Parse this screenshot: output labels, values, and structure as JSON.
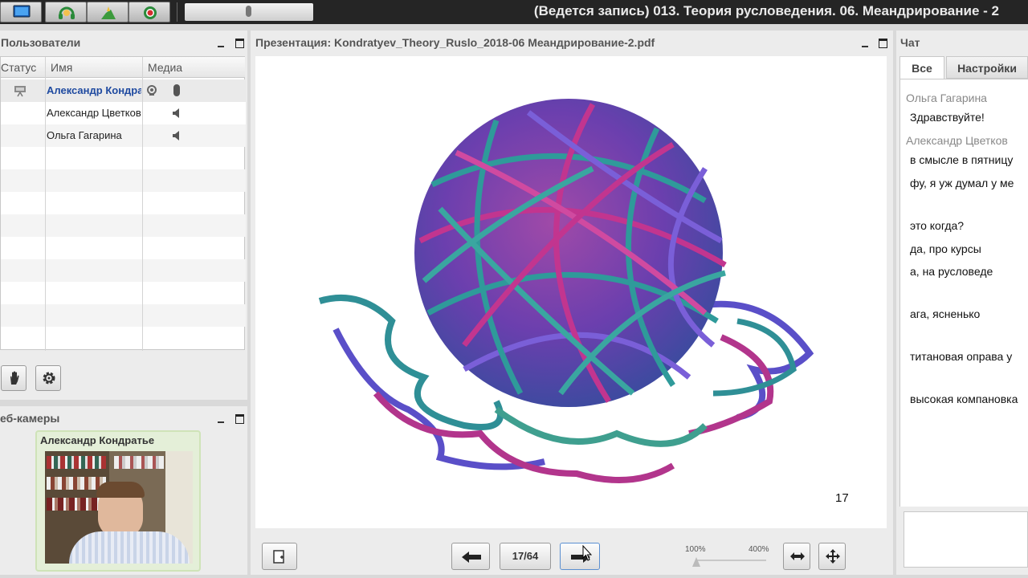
{
  "window": {
    "title": "(Ведется запись) 013. Теория русловедения. 06. Меандрирование - 2"
  },
  "toolbar": {
    "buttons": [
      {
        "name": "desktop-share",
        "icon": "monitor-icon"
      },
      {
        "name": "headset",
        "icon": "headset-icon"
      },
      {
        "name": "upload-document",
        "icon": "document-upload-icon"
      },
      {
        "name": "record",
        "icon": "record-icon"
      }
    ]
  },
  "users_panel": {
    "title": "Пользователи",
    "columns": [
      "Статус",
      "Имя",
      "Медиа"
    ],
    "rows": [
      {
        "name": "Александр Кондра",
        "presenter": true
      },
      {
        "name": "Александр Цветков",
        "presenter": false
      },
      {
        "name": "Ольга Гагарина",
        "presenter": false
      }
    ]
  },
  "webcam_panel": {
    "title": "Веб-камеры",
    "title_visible": "еб-камеры",
    "user": "Александр Кондратье"
  },
  "presentation": {
    "title": "Презентация: Kondratyev_Theory_Ruslo_2018-06 Меандрирование-2.pdf",
    "slide_number": "17",
    "page_counter": "17/64",
    "zoom_min": "100%",
    "zoom_max": "400%",
    "zoom_level": 0
  },
  "chat_panel": {
    "title": "Чат",
    "tabs": [
      "Все",
      "Настройки"
    ],
    "messages": [
      {
        "type": "name",
        "text": "Ольга Гагарина"
      },
      {
        "type": "text",
        "text": "Здравствуйте!"
      },
      {
        "type": "name",
        "text": "Александр Цветков"
      },
      {
        "type": "text",
        "text": "в смысле в пятницу"
      },
      {
        "type": "text",
        "text": "фу, я уж думал у ме"
      },
      {
        "type": "text",
        "text": "это когда?"
      },
      {
        "type": "text",
        "text": "да, про курсы"
      },
      {
        "type": "text",
        "text": "а, на русловеде"
      },
      {
        "type": "text",
        "text": "ага, ясненько"
      },
      {
        "type": "text",
        "text": "титановая оправа у"
      },
      {
        "type": "text",
        "text": "высокая компановка"
      }
    ]
  }
}
